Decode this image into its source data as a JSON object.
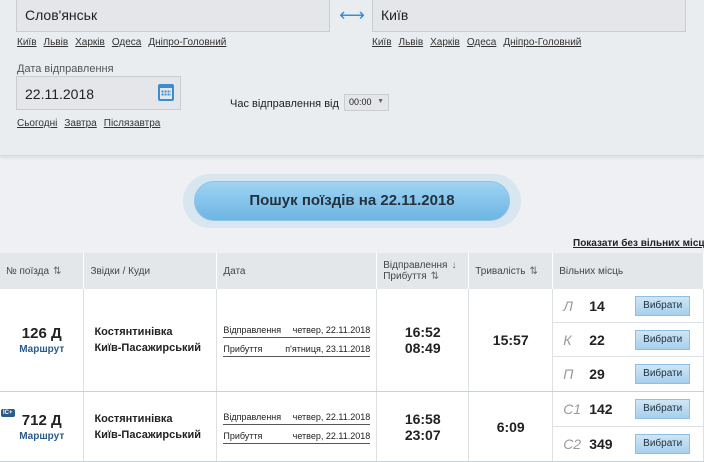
{
  "search_form": {
    "from_value": "Слов'янськ",
    "to_value": "Київ",
    "swap_icon": "swap-arrows-icon",
    "from_quick_links": [
      "Київ",
      "Львів",
      "Харків",
      "Одеса",
      "Дніпро-Головний"
    ],
    "to_quick_links": [
      "Київ",
      "Львів",
      "Харків",
      "Одеса",
      "Дніпро-Головний"
    ],
    "date_label": "Дата відправлення",
    "date_value": "22.11.2018",
    "date_quick_links": [
      "Сьогодні",
      "Завтра",
      "Післязавтра"
    ],
    "time_label": "Час відправлення від",
    "time_value": "00:00",
    "search_button": "Пошук поїздів на 22.11.2018"
  },
  "show_all_link": "Показати без вільних місць",
  "table": {
    "headers": {
      "number": "№ поїзда",
      "route": "Звідки / Куди",
      "date": "Дата",
      "dep_arr": "Відправлення",
      "dep_arr2": "Прибуття",
      "duration": "Тривалість",
      "seats": "Вільних місць"
    },
    "rows": [
      {
        "number": "126 Д",
        "route_link": "Маршрут",
        "badge": "",
        "from": "Костянтинівка",
        "to": "Київ-Пасажирський",
        "dep_label": "Відправлення",
        "dep_date": "четвер, 22.11.2018",
        "arr_label": "Прибуття",
        "arr_date": "п'ятниця, 23.11.2018",
        "dep_time": "16:52",
        "arr_time": "08:49",
        "duration": "15:57",
        "seats": [
          {
            "class": "Л",
            "count": "14",
            "button": "Вибрати"
          },
          {
            "class": "К",
            "count": "22",
            "button": "Вибрати"
          },
          {
            "class": "П",
            "count": "29",
            "button": "Вибрати"
          }
        ]
      },
      {
        "number": "712 Д",
        "route_link": "Маршрут",
        "badge": "IC+",
        "from": "Костянтинівка",
        "to": "Київ-Пасажирський",
        "dep_label": "Відправлення",
        "dep_date": "четвер, 22.11.2018",
        "arr_label": "Прибуття",
        "arr_date": "четвер, 22.11.2018",
        "dep_time": "16:58",
        "arr_time": "23:07",
        "duration": "6:09",
        "seats": [
          {
            "class": "С1",
            "count": "142",
            "button": "Вибрати"
          },
          {
            "class": "С2",
            "count": "349",
            "button": "Вибрати"
          }
        ]
      }
    ]
  }
}
